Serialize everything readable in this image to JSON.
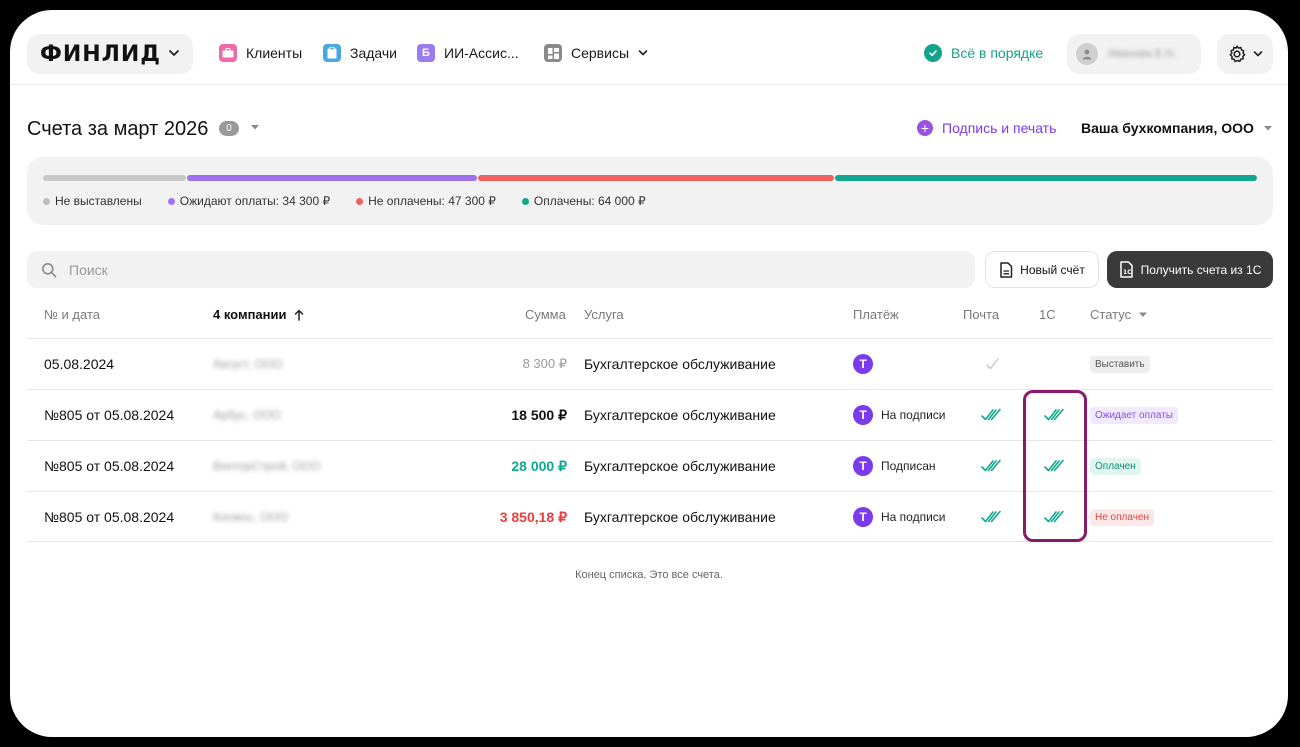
{
  "header": {
    "logo": "ФИНЛИД",
    "nav": [
      {
        "label": "Клиенты",
        "icon": "briefcase-icon",
        "color": "#f06aa8"
      },
      {
        "label": "Задачи",
        "icon": "clipboard-icon",
        "color": "#4aa8e0"
      },
      {
        "label": "ИИ-Ассис...",
        "icon": "ai-assistant-icon",
        "color": "#9b7bf0"
      },
      {
        "label": "Сервисы",
        "icon": "grid-icon",
        "color": "#8a8a8a"
      }
    ],
    "status": "Всё в порядке",
    "user_name": "Иванова Е.Н."
  },
  "page": {
    "title": "Счета за март 2026",
    "count": "0",
    "sign_print": "Подпись и печать",
    "company": "Ваша бухкомпания, ООО"
  },
  "summary": {
    "segments": [
      {
        "label": "Не выставлены",
        "color": "#c8c8c8",
        "share": 0.13
      },
      {
        "label": "Ожидают оплаты: 34 300 ₽",
        "color": "#a071ef",
        "share": 0.24
      },
      {
        "label": "Не оплачены: 47 300 ₽",
        "color": "#f06262",
        "share": 0.29
      },
      {
        "label": "Оплачены: 64 000 ₽",
        "color": "#11a78f",
        "share": 0.34
      }
    ]
  },
  "search": {
    "placeholder": "Поиск"
  },
  "buttons": {
    "new_invoice": "Новый счёт",
    "get_1c": "Получить счета из 1С"
  },
  "table": {
    "headers": {
      "number": "№ и дата",
      "company": "4 компании",
      "sum": "Сумма",
      "service": "Услуга",
      "payment": "Платёж",
      "mail": "Почта",
      "onec": "1С",
      "status": "Статус"
    },
    "rows": [
      {
        "number": "05.08.2024",
        "company": "Август, ООО",
        "sum": "8 300 ₽",
        "sum_color": "#9a9a9a",
        "service": "Бухгалтерское обслуживание",
        "payment": "",
        "mail": "single",
        "onec": "none",
        "status": "Выставить",
        "status_fg": "#555555",
        "status_bg": "#eeeeee"
      },
      {
        "number": "№805 от 05.08.2024",
        "company": "Арбус, ООО",
        "sum": "18 500 ₽",
        "sum_color": "#111111",
        "service": "Бухгалтерское обслуживание",
        "payment": "На подписи",
        "mail": "double",
        "onec": "double",
        "status": "Ожидает оплаты",
        "status_fg": "#8a4fe0",
        "status_bg": "#f1e9fd"
      },
      {
        "number": "№805 от 05.08.2024",
        "company": "ВекторСтрой, ООО",
        "sum": "28 000 ₽",
        "sum_color": "#11a78f",
        "service": "Бухгалтерское обслуживание",
        "payment": "Подписан",
        "mail": "double",
        "onec": "double",
        "status": "Оплачен",
        "status_fg": "#0d8f78",
        "status_bg": "#e1f6f1"
      },
      {
        "number": "№805 от 05.08.2024",
        "company": "Космос, ООО",
        "sum": "3 850,18 ₽",
        "sum_color": "#ef3b3b",
        "service": "Бухгалтерское обслуживание",
        "payment": "На подписи",
        "mail": "double",
        "onec": "double",
        "status": "Не оплачен",
        "status_fg": "#e14646",
        "status_bg": "#fde8e8"
      }
    ],
    "end_note": "Конец списка. Это все счета."
  }
}
